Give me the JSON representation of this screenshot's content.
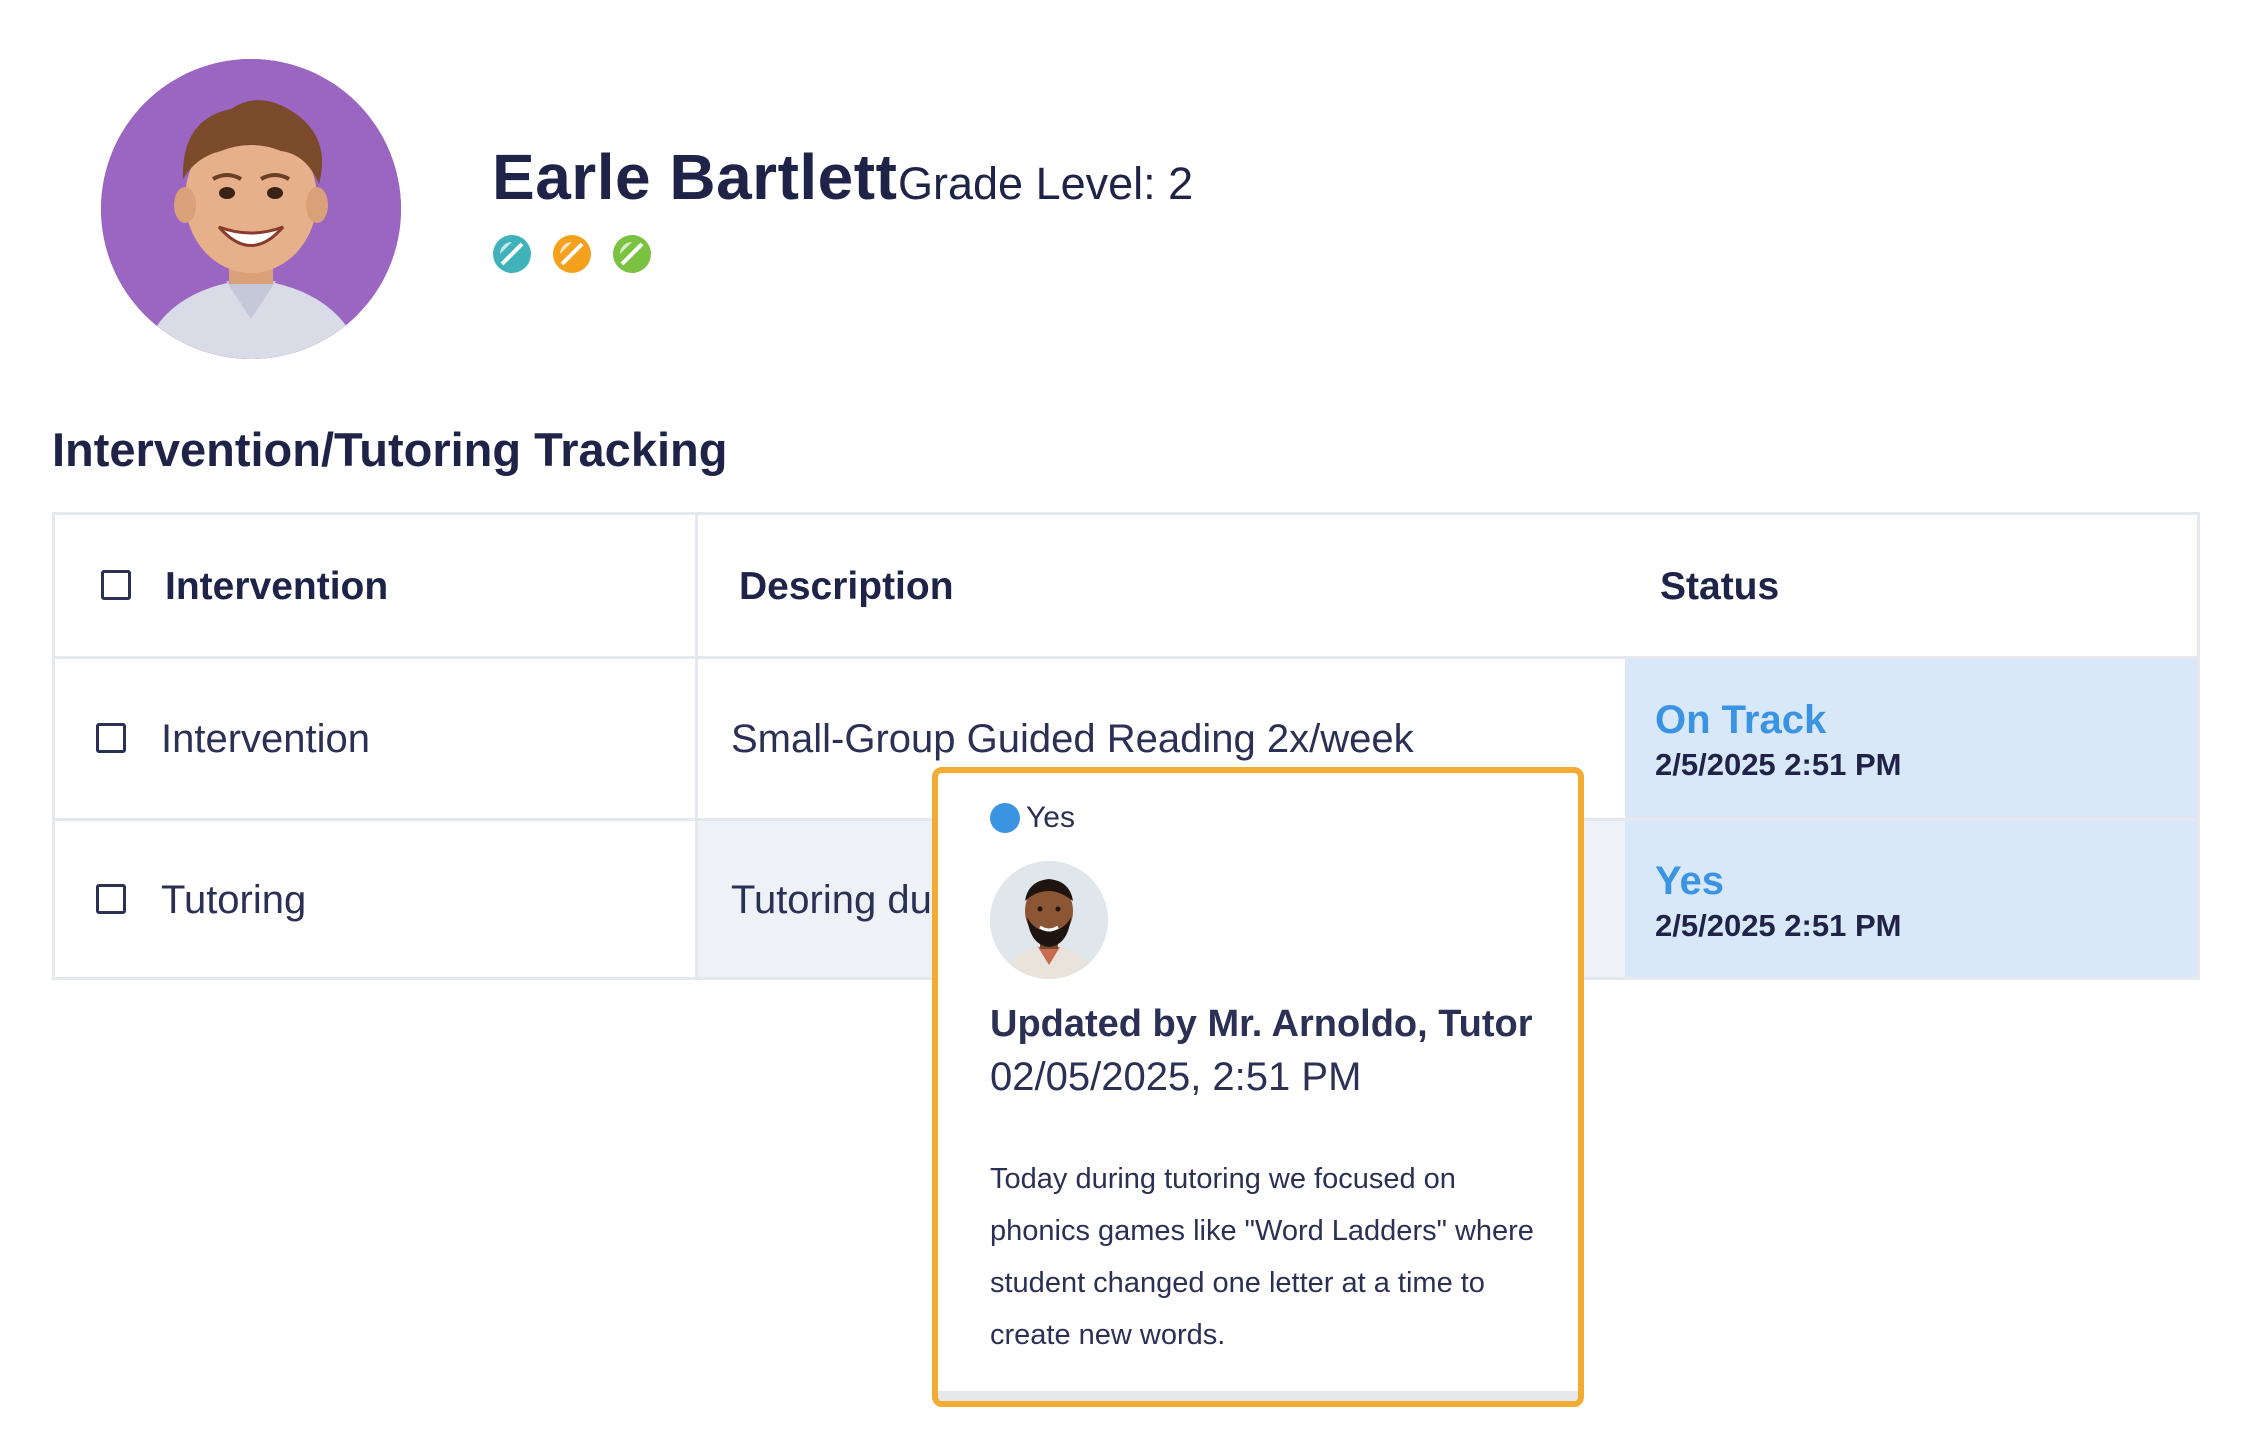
{
  "student": {
    "name": "Earle Bartlett",
    "grade_level": "Grade Level: 2",
    "badges": [
      {
        "icon": "teal-progress-badge-icon",
        "color": "#3fb3b9"
      },
      {
        "icon": "orange-progress-badge-icon",
        "color": "#f4a21d"
      },
      {
        "icon": "green-progress-badge-icon",
        "color": "#7cc242"
      }
    ]
  },
  "section": {
    "title": "Intervention/Tutoring Tracking"
  },
  "table": {
    "headers": {
      "intervention": "Intervention",
      "description": "Description",
      "status": "Status"
    },
    "rows": [
      {
        "intervention": "Intervention",
        "description": "Small-Group Guided Reading 2x/week",
        "status": "On Track",
        "status_date": "2/5/2025 2:51 PM"
      },
      {
        "intervention": "Tutoring",
        "description": "Tutoring du",
        "status": "Yes",
        "status_date": "2/5/2025 2:51 PM"
      }
    ]
  },
  "popup": {
    "status": "Yes",
    "updated_by": "Updated by Mr. Arnoldo, Tutor",
    "updated_time": "02/05/2025, 2:51 PM",
    "note": "Today during tutoring we focused on phonics games like \"Word Ladders\" where student changed one letter at a time to create new words."
  },
  "colors": {
    "accent_blue": "#3b94e2",
    "popup_border": "#f2ac33",
    "status_cell_bg": "#d9e8f8",
    "text_navy": "#1f2347"
  }
}
